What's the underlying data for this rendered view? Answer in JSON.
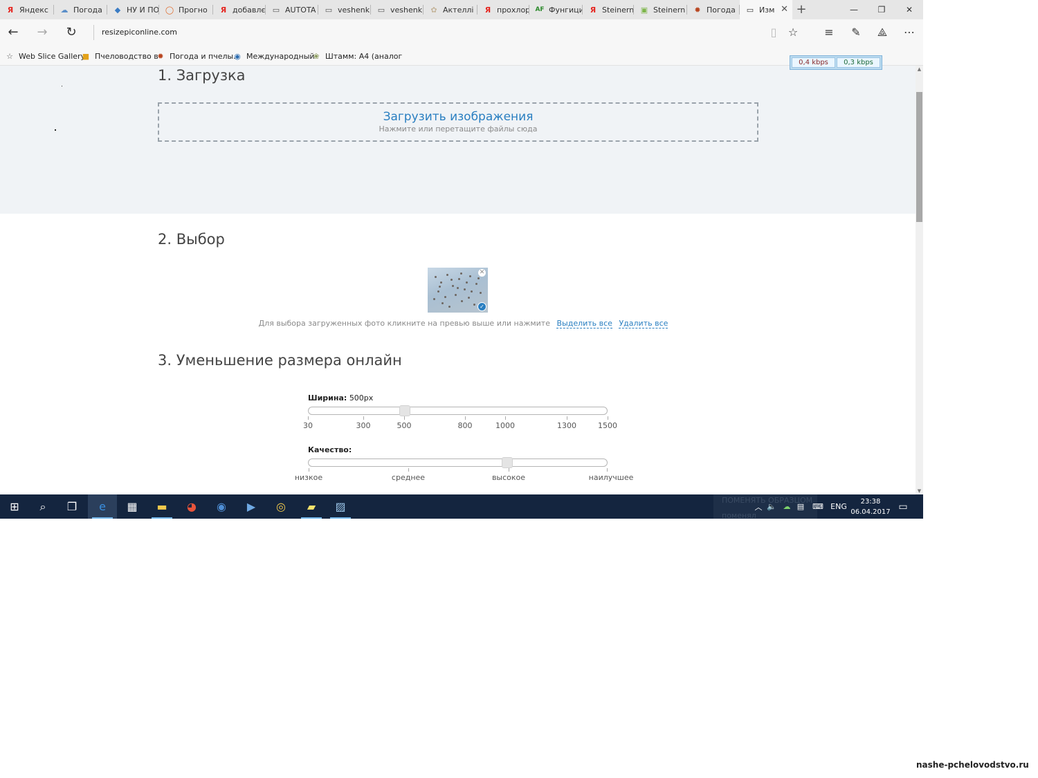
{
  "tabs": [
    {
      "label": "Яндекс",
      "icon": "yandex-icon",
      "glyph": "Я",
      "color": "#e52620"
    },
    {
      "label": "Погода",
      "icon": "weather-icon",
      "glyph": "☁",
      "color": "#5b8fc9"
    },
    {
      "label": "НУ И ПО",
      "icon": "site-icon",
      "glyph": "◆",
      "color": "#3a7cc4"
    },
    {
      "label": "Прогно",
      "icon": "forecast-icon",
      "glyph": "◯",
      "color": "#e06a2a"
    },
    {
      "label": "добавлє",
      "icon": "yandex-icon",
      "glyph": "Я",
      "color": "#e52620"
    },
    {
      "label": "AUTOTA",
      "icon": "page-icon",
      "glyph": "▭",
      "color": "#555555"
    },
    {
      "label": "veshenk",
      "icon": "page-icon",
      "glyph": "▭",
      "color": "#555555"
    },
    {
      "label": "veshenk",
      "icon": "page-icon",
      "glyph": "▭",
      "color": "#555555"
    },
    {
      "label": "Актеллі",
      "icon": "flower-icon",
      "glyph": "✿",
      "color": "#c4b49a"
    },
    {
      "label": "прохлор",
      "icon": "yandex-icon",
      "glyph": "Я",
      "color": "#e52620"
    },
    {
      "label": "Фунгици",
      "icon": "af-icon",
      "glyph": "AF",
      "color": "#2e8b2e"
    },
    {
      "label": "Steinern",
      "icon": "yandex-icon",
      "glyph": "Я",
      "color": "#e52620"
    },
    {
      "label": "Steinern",
      "icon": "download-icon",
      "glyph": "▣",
      "color": "#7db54a"
    },
    {
      "label": "Погода",
      "icon": "bee-icon",
      "glyph": "✹",
      "color": "#b8441e"
    },
    {
      "label": "Изм",
      "icon": "page-icon",
      "glyph": "▭",
      "color": "#333333"
    }
  ],
  "window": {
    "new_tab": "+",
    "minimize": "—",
    "restore": "❐",
    "close": "✕"
  },
  "nav": {
    "back": "←",
    "forward": "→",
    "refresh": "↻",
    "address": "resizepiconline.com"
  },
  "favorites": [
    {
      "label": "Web Slice Gallery",
      "icon": "star-outline-icon",
      "glyph": "☆",
      "color": "#555555"
    },
    {
      "label": "Пчеловодство в",
      "icon": "honeycomb-icon",
      "glyph": "■",
      "color": "#e3a21a"
    },
    {
      "label": "Погода и пчелы.",
      "icon": "bee-icon",
      "glyph": "✹",
      "color": "#b8441e"
    },
    {
      "label": "Международный",
      "icon": "globe-icon",
      "glyph": "◉",
      "color": "#2b6cb0"
    },
    {
      "label": "Штамм: А4 (аналог",
      "icon": "plant-icon",
      "glyph": "❀",
      "color": "#8a9a5b"
    }
  ],
  "speed": {
    "down": "0,4 kbps",
    "up": "0,3 kbps",
    "down_color": "#8a2a2a",
    "up_color": "#1e6b3a"
  },
  "page": {
    "section1_title": "1. Загрузка",
    "upload_main": "Загрузить изображения",
    "upload_sub": "Нажмите или перетащите файлы сюда",
    "section2_title": "2. Выбор",
    "select_hint": "Для выбора загруженных фото кликните на превью выше или нажмите",
    "select_all": "Выделить все",
    "delete_all": "Удалить все",
    "section3_title": "3. Уменьшение размера онлайн",
    "width_label": "Ширина:",
    "width_value": "500px",
    "width_slider": {
      "min": 30,
      "max": 1500,
      "value": 500,
      "ticks": [
        "30",
        "300",
        "500",
        "800",
        "1000",
        "1300",
        "1500"
      ]
    },
    "quality_label": "Качество:",
    "quality_slider": {
      "value_fraction": 0.667,
      "ticks": [
        "низкое",
        "среднее",
        "высокое",
        "наилучшее"
      ]
    }
  },
  "taskbar": {
    "apps": [
      {
        "name": "windows-start-icon",
        "glyph": "⊞"
      },
      {
        "name": "search-icon",
        "glyph": "⌕"
      },
      {
        "name": "task-view-icon",
        "glyph": "❐"
      },
      {
        "name": "edge-icon",
        "glyph": "e"
      },
      {
        "name": "store-icon",
        "glyph": "▦"
      },
      {
        "name": "file-explorer-icon",
        "glyph": "▬"
      },
      {
        "name": "paint-icon",
        "glyph": "◕"
      },
      {
        "name": "firefox-icon",
        "glyph": "◉"
      },
      {
        "name": "media-player-icon",
        "glyph": "▶"
      },
      {
        "name": "chrome-icon",
        "glyph": "◎"
      },
      {
        "name": "sticky-notes-icon",
        "glyph": "▰"
      },
      {
        "name": "photos-icon",
        "glyph": "▨"
      }
    ],
    "ghost_line1": "ПОМЕНЯТЬ ОБРАЗЦОМ",
    "ghost_line2": "поменял",
    "tray_up": "︿",
    "tray_volume": "🔈",
    "tray_network": "▤",
    "tray_keyboard": "⌨",
    "language": "ENG",
    "time": "23:38",
    "date": "06.04.2017",
    "notifications": "▭"
  },
  "watermark": "nashe-pchelovodstvo.ru"
}
